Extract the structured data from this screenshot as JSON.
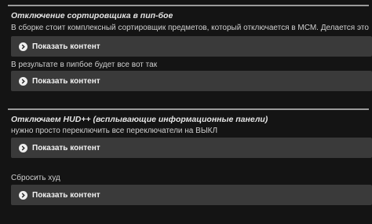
{
  "sections": [
    {
      "heading": "Отключение сортировщика в пип-бое",
      "text": "В сборке стоит комплексный сортировщик предметов, который отключается в МСМ. Делается это так",
      "spoiler_label": "Показать контент"
    },
    {
      "text": "В результате в пипбое будет все вот так",
      "spoiler_label": "Показать контент"
    },
    {
      "heading": "Отключаем HUD++ (всплывающие информационные панели)",
      "text": "нужно просто переключить все переключатели на ВЫКЛ",
      "spoiler_label": "Показать контент"
    },
    {
      "text": "Сбросить худ",
      "spoiler_label": "Показать контент"
    }
  ],
  "icons": {
    "spoiler": "chevron-right-circle-icon"
  },
  "colors": {
    "background": "#141414",
    "spoiler_bg": "#3a3a3a",
    "divider": "#9a9a9a"
  }
}
